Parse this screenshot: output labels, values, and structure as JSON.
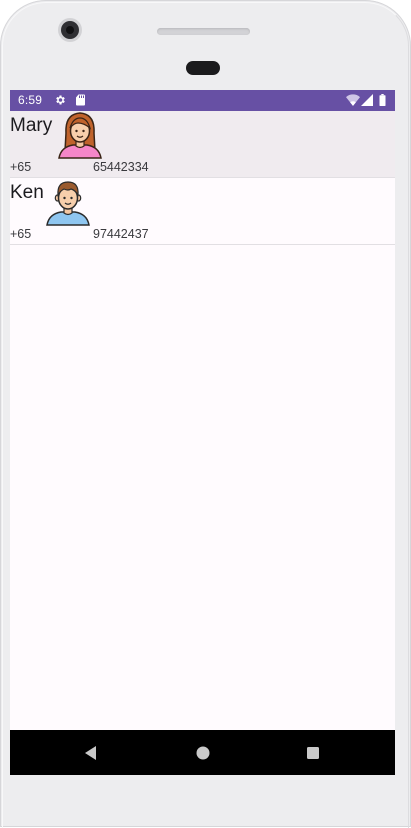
{
  "status_bar": {
    "time": "6:59",
    "background": "#6750a4",
    "icons": [
      "gear-icon",
      "sd-card-icon",
      "wifi-icon",
      "signal-icon",
      "battery-icon"
    ]
  },
  "contacts": [
    {
      "name": "Mary",
      "country_code": "+65",
      "phone": "65442334",
      "avatar_icon": "woman-avatar-icon",
      "selected": true
    },
    {
      "name": "Ken",
      "country_code": "+65",
      "phone": "97442437",
      "avatar_icon": "man-avatar-icon",
      "selected": false
    }
  ],
  "nav_bar": {
    "buttons": [
      "back-icon",
      "home-icon",
      "recents-icon"
    ]
  }
}
